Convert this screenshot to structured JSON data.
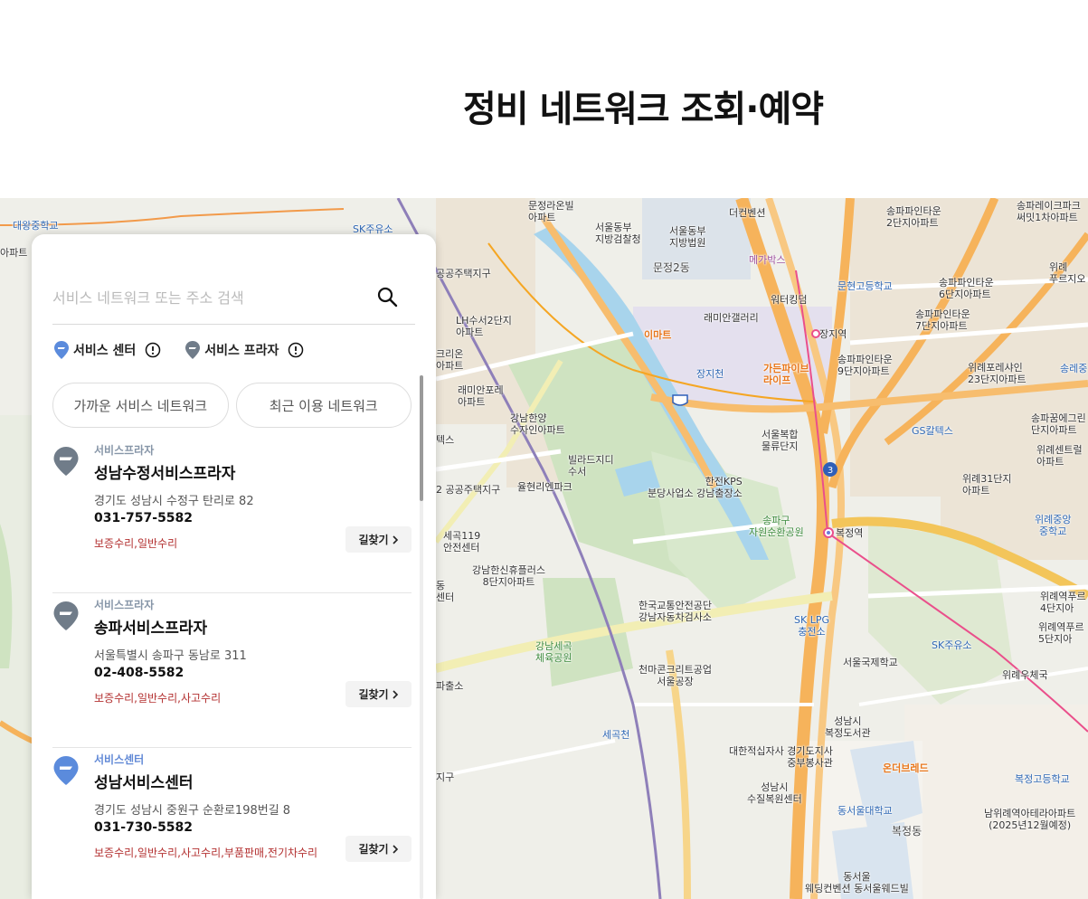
{
  "page": {
    "title": "정비 네트워크 조회·예약"
  },
  "search": {
    "placeholder": "서비스 네트워크 또는 주소 검색"
  },
  "legend": [
    {
      "label": "서비스 센터",
      "color": "#5b8bdc"
    },
    {
      "label": "서비스 프라자",
      "color": "#707c89"
    }
  ],
  "toggles": [
    {
      "label": "가까운 서비스 네트워크"
    },
    {
      "label": "최근 이용 네트워크"
    }
  ],
  "route_label": "길찾기",
  "scroll": {
    "position": 0.0,
    "visible_fraction": 0.24
  },
  "results": [
    {
      "type": "서비스프라자",
      "name": "성남수정서비스프라자",
      "address": "경기도 성남시 수정구 탄리로 82",
      "phone": "031-757-5582",
      "services": "보증수리,일반수리"
    },
    {
      "type": "서비스프라자",
      "name": "송파서비스프라자",
      "address": "서울특별시 송파구 동남로 311",
      "phone": "02-408-5582",
      "services": "보증수리,일반수리,사고수리"
    },
    {
      "type": "서비스센터",
      "name": "성남서비스센터",
      "address": "경기도 성남시 중원구 순환로198번길 8",
      "phone": "031-730-5582",
      "services": "보증수리,일반수리,사고수리,부품판매,전기차수리"
    }
  ],
  "map": {
    "labels": [
      {
        "text": "대왕중학교",
        "class": "poi-edu"
      },
      {
        "text": "SK주유소",
        "class": "poi-edu"
      },
      {
        "text": "아파트",
        "class": ""
      },
      {
        "text": "문정라온빌\n아파트",
        "class": ""
      },
      {
        "text": "서울동부\n지방검찰청",
        "class": ""
      },
      {
        "text": "서울동부\n지방법원",
        "class": ""
      },
      {
        "text": "더컨벤션",
        "class": ""
      },
      {
        "text": "송파파인타운\n2단지아파트",
        "class": ""
      },
      {
        "text": "송파레이크파크\n써밋1차아파트",
        "class": ""
      },
      {
        "text": "문정2동",
        "class": "big"
      },
      {
        "text": "메가박스",
        "class": "poi-purple"
      },
      {
        "text": "공공주택지구",
        "class": ""
      },
      {
        "text": "문현고등학교",
        "class": "poi-edu"
      },
      {
        "text": "송파파인타운\n6단지아파트",
        "class": ""
      },
      {
        "text": "위례\n푸르지오",
        "class": ""
      },
      {
        "text": "LH수서2단지\n아파트",
        "class": ""
      },
      {
        "text": "래미안갤러리",
        "class": ""
      },
      {
        "text": "워터킹덤",
        "class": ""
      },
      {
        "text": "송파파인타운\n7단지아파트",
        "class": ""
      },
      {
        "text": "이마트",
        "class": "poi-brand"
      },
      {
        "text": "장지역",
        "class": ""
      },
      {
        "text": "크리온\n아파트",
        "class": ""
      },
      {
        "text": "장지천",
        "class": "poi-edu"
      },
      {
        "text": "가든파이브\n라이프",
        "class": "poi-brand"
      },
      {
        "text": "송파파인타운\n9단지아파트",
        "class": ""
      },
      {
        "text": "위례포레샤인\n23단지아파트",
        "class": ""
      },
      {
        "text": "송레중",
        "class": "poi-edu"
      },
      {
        "text": "래미안포레\n아파트",
        "class": ""
      },
      {
        "text": "강남한양\n수자인아파트",
        "class": ""
      },
      {
        "text": "서울복합\n물류단지",
        "class": ""
      },
      {
        "text": "송파꿈에그린\n단지아파트",
        "class": ""
      },
      {
        "text": "GS칼텍스",
        "class": "poi-edu"
      },
      {
        "text": "위례센트럴\n아파트",
        "class": ""
      },
      {
        "text": "빌라드지디\n수서",
        "class": ""
      },
      {
        "text": "율현리엔파크",
        "class": ""
      },
      {
        "text": "한전KPS\n분당사업소 강남출장소",
        "class": ""
      },
      {
        "text": "위례31단지\n아파트",
        "class": ""
      },
      {
        "text": "2 공공주택지구",
        "class": ""
      },
      {
        "text": "송파구\n자원순환공원",
        "class": "poi-park"
      },
      {
        "text": "복정역",
        "class": ""
      },
      {
        "text": "위례중앙\n중학교",
        "class": "poi-edu"
      },
      {
        "text": "세곡119\n안전센터",
        "class": ""
      },
      {
        "text": "강남한신휴플러스\n8단지아파트",
        "class": ""
      },
      {
        "text": "한국교통안전공단\n강남자동차검사소",
        "class": ""
      },
      {
        "text": "SK LPG\n충전소",
        "class": "poi-edu"
      },
      {
        "text": "위례역푸르\n4단지아",
        "class": ""
      },
      {
        "text": "강남세곡\n체육공원",
        "class": "poi-park"
      },
      {
        "text": "SK주유소",
        "class": "poi-edu"
      },
      {
        "text": "위례역푸르\n5단지아",
        "class": ""
      },
      {
        "text": "천마콘크리트공업\n서울공장",
        "class": ""
      },
      {
        "text": "서울국제학교",
        "class": ""
      },
      {
        "text": "위례우체국",
        "class": ""
      },
      {
        "text": "파출소",
        "class": ""
      },
      {
        "text": "세곡천",
        "class": "poi-edu"
      },
      {
        "text": "성남시\n복정도서관",
        "class": ""
      },
      {
        "text": "대한적십자사 경기도지사\n중부봉사관",
        "class": ""
      },
      {
        "text": "온더브레드",
        "class": "poi-brand"
      },
      {
        "text": "복정고등학교",
        "class": "poi-edu"
      },
      {
        "text": "성남시\n수질복원센터",
        "class": ""
      },
      {
        "text": "동서울대학교",
        "class": "poi-edu"
      },
      {
        "text": "남위례역아테라아파트\n(2025년12월예정)",
        "class": ""
      },
      {
        "text": "복정동",
        "class": "big"
      },
      {
        "text": "동서울\n웨딩컨벤션 동서울웨드빌",
        "class": ""
      },
      {
        "text": "지구",
        "class": ""
      },
      {
        "text": "동\n센터",
        "class": ""
      },
      {
        "text": "텍스",
        "class": ""
      }
    ]
  }
}
